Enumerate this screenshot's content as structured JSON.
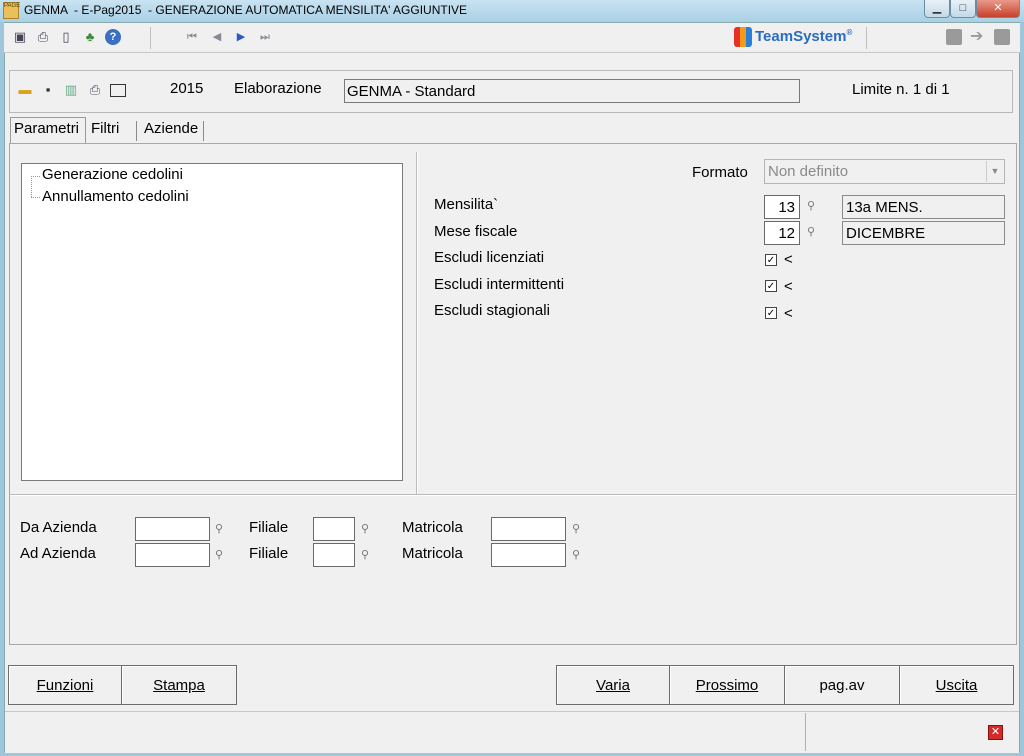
{
  "window": {
    "title": "GENMA  - E-Pag2015  - GENERAZIONE AUTOMATICA MENSILITA' AGGIUNTIVE",
    "app_icon_text": "PAGE"
  },
  "toolbar": {
    "icons": [
      "screen-icon",
      "print-icon",
      "clipboard-icon",
      "tools-icon",
      "help-icon"
    ],
    "nav_icons": [
      "first-icon",
      "prev-icon",
      "next-icon",
      "last-icon"
    ],
    "brand": "TeamSystem",
    "brand_mark": "®"
  },
  "header": {
    "icons": [
      "folder-icon",
      "save-icon",
      "delete-icon",
      "printer-icon",
      "blank-icon"
    ],
    "year": "2015",
    "elaborazione_label": "Elaborazione",
    "elaborazione_value": "GENMA - Standard",
    "limite": "Limite n. 1 di 1"
  },
  "tabs": [
    {
      "label": "Parametri",
      "active": true
    },
    {
      "label": "Filtri",
      "active": false
    },
    {
      "label": "Aziende",
      "active": false
    }
  ],
  "tree": {
    "items": [
      "Generazione cedolini",
      "Annullamento cedolini"
    ]
  },
  "params": {
    "formato_label": "Formato",
    "formato_value": "Non definito",
    "mensilita_label": "Mensilita`",
    "mensilita_value": "13",
    "mensilita_desc": "13a MENS.",
    "mese_label": "Mese fiscale",
    "mese_value": "12",
    "mese_desc": "DICEMBRE",
    "checks": [
      {
        "label": "Escludi licenziati",
        "checked": true,
        "suffix": "<"
      },
      {
        "label": "Escludi intermittenti",
        "checked": true,
        "suffix": "<"
      },
      {
        "label": "Escludi stagionali",
        "checked": true,
        "suffix": "<"
      }
    ]
  },
  "filters": {
    "row1": {
      "azienda": "Da Azienda",
      "filiale": "Filiale",
      "matricola": "Matricola"
    },
    "row2": {
      "azienda": "Ad Azienda",
      "filiale": "Filiale",
      "matricola": "Matricola"
    }
  },
  "buttons": {
    "funzioni": "Funzioni",
    "stampa": "Stampa",
    "varia": "Varia",
    "prossimo": "Prossimo",
    "pagav": "pag.av",
    "uscita": "Uscita"
  }
}
